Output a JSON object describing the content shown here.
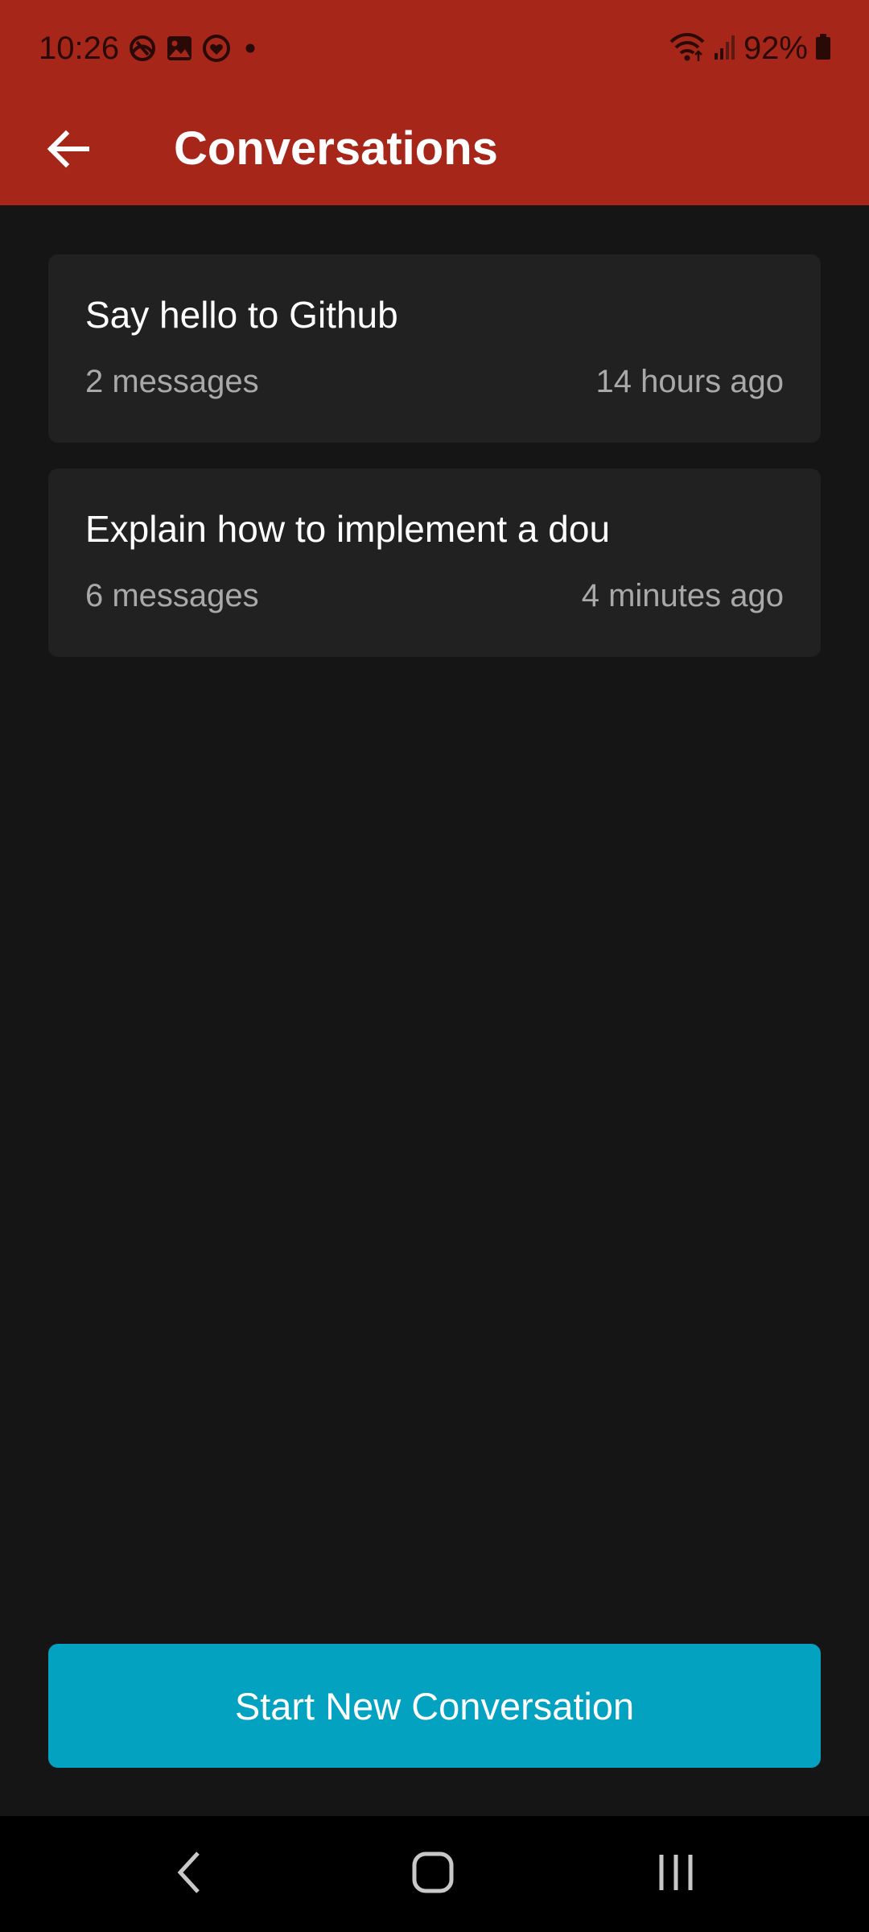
{
  "status_bar": {
    "time": "10:26",
    "battery_percent": "92%",
    "icons_left": [
      "sync-icon",
      "gallery-icon",
      "heart-app-icon",
      "notification-dot-icon"
    ],
    "icons_right": [
      "wifi-icon",
      "signal-icon",
      "battery-icon"
    ]
  },
  "app_bar": {
    "title": "Conversations",
    "back_icon": "arrow-left-icon"
  },
  "conversations": [
    {
      "title": "Say hello to Github",
      "count": "2 messages",
      "time": "14 hours ago"
    },
    {
      "title": "Explain how to implement a dou",
      "count": "6 messages",
      "time": "4 minutes ago"
    }
  ],
  "actions": {
    "new_conversation": "Start New Conversation"
  },
  "nav_bar": {
    "buttons": [
      "back-nav-icon",
      "home-nav-icon",
      "recents-nav-icon"
    ]
  },
  "colors": {
    "app_bar": "#a6261a",
    "background": "#151515",
    "card": "#212121",
    "button": "#02a2c0"
  }
}
